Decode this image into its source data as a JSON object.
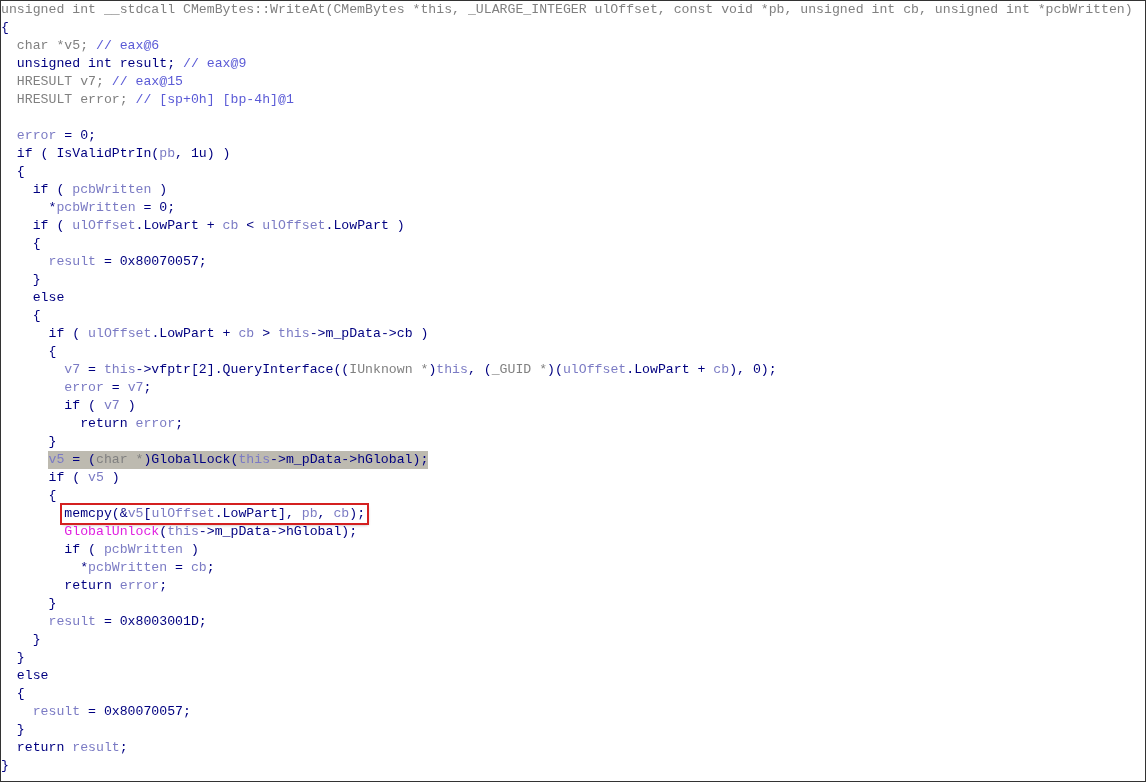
{
  "pseudocode": {
    "lines": [
      {
        "highlighted": false,
        "boxed": false,
        "segments": [
          {
            "kind": "decl",
            "text": "unsigned int __stdcall CMemBytes::WriteAt(CMemBytes *this, _ULARGE_INTEGER ulOffset, const void *pb, unsigned int cb, unsigned int *pcbWritten)"
          }
        ]
      },
      {
        "highlighted": false,
        "boxed": false,
        "segments": [
          {
            "kind": "plain",
            "text": "{"
          }
        ]
      },
      {
        "highlighted": false,
        "boxed": false,
        "segments": [
          {
            "kind": "type",
            "text": "  char *v5; "
          },
          {
            "kind": "comment",
            "text": "// eax@6"
          }
        ]
      },
      {
        "highlighted": false,
        "boxed": false,
        "segments": [
          {
            "kind": "plain",
            "text": "  unsigned int result; "
          },
          {
            "kind": "comment",
            "text": "// eax@9"
          }
        ]
      },
      {
        "highlighted": false,
        "boxed": false,
        "segments": [
          {
            "kind": "type",
            "text": "  HRESULT v7; "
          },
          {
            "kind": "comment",
            "text": "// eax@15"
          }
        ]
      },
      {
        "highlighted": false,
        "boxed": false,
        "segments": [
          {
            "kind": "type",
            "text": "  HRESULT error; "
          },
          {
            "kind": "comment",
            "text": "// [sp+0h] [bp-4h]@1"
          }
        ]
      },
      {
        "highlighted": false,
        "boxed": false
      },
      {
        "highlighted": false,
        "boxed": false,
        "segments": [
          {
            "kind": "var",
            "text": "  error"
          },
          {
            "kind": "plain",
            "text": " = 0;"
          }
        ]
      },
      {
        "highlighted": false,
        "boxed": false,
        "segments": [
          {
            "kind": "plain",
            "text": "  if ( IsValidPtrIn("
          },
          {
            "kind": "var",
            "text": "pb"
          },
          {
            "kind": "plain",
            "text": ", 1u) )"
          }
        ]
      },
      {
        "highlighted": false,
        "boxed": false,
        "segments": [
          {
            "kind": "plain",
            "text": "  {"
          }
        ]
      },
      {
        "highlighted": false,
        "boxed": false,
        "segments": [
          {
            "kind": "plain",
            "text": "    if ( "
          },
          {
            "kind": "var",
            "text": "pcbWritten"
          },
          {
            "kind": "plain",
            "text": " )"
          }
        ]
      },
      {
        "highlighted": false,
        "boxed": false,
        "segments": [
          {
            "kind": "plain",
            "text": "      *"
          },
          {
            "kind": "var",
            "text": "pcbWritten"
          },
          {
            "kind": "plain",
            "text": " = 0;"
          }
        ]
      },
      {
        "highlighted": false,
        "boxed": false,
        "segments": [
          {
            "kind": "plain",
            "text": "    if ( "
          },
          {
            "kind": "var",
            "text": "ulOffset"
          },
          {
            "kind": "plain",
            "text": ".LowPart + "
          },
          {
            "kind": "var",
            "text": "cb"
          },
          {
            "kind": "plain",
            "text": " < "
          },
          {
            "kind": "var",
            "text": "ulOffset"
          },
          {
            "kind": "plain",
            "text": ".LowPart )"
          }
        ]
      },
      {
        "highlighted": false,
        "boxed": false,
        "segments": [
          {
            "kind": "plain",
            "text": "    {"
          }
        ]
      },
      {
        "highlighted": false,
        "boxed": false,
        "segments": [
          {
            "kind": "var",
            "text": "      result"
          },
          {
            "kind": "plain",
            "text": " = 0x80070057;"
          }
        ]
      },
      {
        "highlighted": false,
        "boxed": false,
        "segments": [
          {
            "kind": "plain",
            "text": "    }"
          }
        ]
      },
      {
        "highlighted": false,
        "boxed": false,
        "segments": [
          {
            "kind": "plain",
            "text": "    else"
          }
        ]
      },
      {
        "highlighted": false,
        "boxed": false,
        "segments": [
          {
            "kind": "plain",
            "text": "    {"
          }
        ]
      },
      {
        "highlighted": false,
        "boxed": false,
        "segments": [
          {
            "kind": "plain",
            "text": "      if ( "
          },
          {
            "kind": "var",
            "text": "ulOffset"
          },
          {
            "kind": "plain",
            "text": ".LowPart + "
          },
          {
            "kind": "var",
            "text": "cb"
          },
          {
            "kind": "plain",
            "text": " > "
          },
          {
            "kind": "var",
            "text": "this"
          },
          {
            "kind": "plain",
            "text": "->m_pData->cb )"
          }
        ]
      },
      {
        "highlighted": false,
        "boxed": false,
        "segments": [
          {
            "kind": "plain",
            "text": "      {"
          }
        ]
      },
      {
        "highlighted": false,
        "boxed": false,
        "segments": [
          {
            "kind": "var",
            "text": "        v7"
          },
          {
            "kind": "plain",
            "text": " = "
          },
          {
            "kind": "var",
            "text": "this"
          },
          {
            "kind": "plain",
            "text": "->vfptr[2].QueryInterface(("
          },
          {
            "kind": "type",
            "text": "IUnknown *"
          },
          {
            "kind": "plain",
            "text": ")"
          },
          {
            "kind": "var",
            "text": "this"
          },
          {
            "kind": "plain",
            "text": ", ("
          },
          {
            "kind": "type",
            "text": "_GUID *"
          },
          {
            "kind": "plain",
            "text": ")("
          },
          {
            "kind": "var",
            "text": "ulOffset"
          },
          {
            "kind": "plain",
            "text": ".LowPart + "
          },
          {
            "kind": "var",
            "text": "cb"
          },
          {
            "kind": "plain",
            "text": "), 0);"
          }
        ]
      },
      {
        "highlighted": false,
        "boxed": false,
        "segments": [
          {
            "kind": "var",
            "text": "        error"
          },
          {
            "kind": "plain",
            "text": " = "
          },
          {
            "kind": "var",
            "text": "v7"
          },
          {
            "kind": "plain",
            "text": ";"
          }
        ]
      },
      {
        "highlighted": false,
        "boxed": false,
        "segments": [
          {
            "kind": "plain",
            "text": "        if ( "
          },
          {
            "kind": "var",
            "text": "v7"
          },
          {
            "kind": "plain",
            "text": " )"
          }
        ]
      },
      {
        "highlighted": false,
        "boxed": false,
        "segments": [
          {
            "kind": "plain",
            "text": "          return "
          },
          {
            "kind": "var",
            "text": "error"
          },
          {
            "kind": "plain",
            "text": ";"
          }
        ]
      },
      {
        "highlighted": false,
        "boxed": false,
        "segments": [
          {
            "kind": "plain",
            "text": "      }"
          }
        ]
      },
      {
        "highlighted": true,
        "boxed": false,
        "segments": [
          {
            "kind": "var",
            "text": "      v5"
          },
          {
            "kind": "plain",
            "text": " = ("
          },
          {
            "kind": "type",
            "text": "char *"
          },
          {
            "kind": "plain",
            "text": ")GlobalLock("
          },
          {
            "kind": "var",
            "text": "this"
          },
          {
            "kind": "plain",
            "text": "->m_pData->hGlobal);"
          }
        ]
      },
      {
        "highlighted": false,
        "boxed": false,
        "segments": [
          {
            "kind": "plain",
            "text": "      if ( "
          },
          {
            "kind": "var",
            "text": "v5"
          },
          {
            "kind": "plain",
            "text": " )"
          }
        ]
      },
      {
        "highlighted": false,
        "boxed": false,
        "segments": [
          {
            "kind": "plain",
            "text": "      {"
          }
        ]
      },
      {
        "highlighted": false,
        "boxed": true,
        "segments": [
          {
            "kind": "plain",
            "text": "        memcpy(&"
          },
          {
            "kind": "var",
            "text": "v5"
          },
          {
            "kind": "plain",
            "text": "["
          },
          {
            "kind": "var",
            "text": "ulOffset"
          },
          {
            "kind": "plain",
            "text": ".LowPart], "
          },
          {
            "kind": "var",
            "text": "pb"
          },
          {
            "kind": "plain",
            "text": ", "
          },
          {
            "kind": "var",
            "text": "cb"
          },
          {
            "kind": "plain",
            "text": ");"
          }
        ]
      },
      {
        "highlighted": false,
        "boxed": false,
        "segments": [
          {
            "kind": "import",
            "text": "        GlobalUnlock"
          },
          {
            "kind": "plain",
            "text": "("
          },
          {
            "kind": "var",
            "text": "this"
          },
          {
            "kind": "plain",
            "text": "->m_pData->hGlobal);"
          }
        ]
      },
      {
        "highlighted": false,
        "boxed": false,
        "segments": [
          {
            "kind": "plain",
            "text": "        if ( "
          },
          {
            "kind": "var",
            "text": "pcbWritten"
          },
          {
            "kind": "plain",
            "text": " )"
          }
        ]
      },
      {
        "highlighted": false,
        "boxed": false,
        "segments": [
          {
            "kind": "plain",
            "text": "          *"
          },
          {
            "kind": "var",
            "text": "pcbWritten"
          },
          {
            "kind": "plain",
            "text": " = "
          },
          {
            "kind": "var",
            "text": "cb"
          },
          {
            "kind": "plain",
            "text": ";"
          }
        ]
      },
      {
        "highlighted": false,
        "boxed": false,
        "segments": [
          {
            "kind": "plain",
            "text": "        return "
          },
          {
            "kind": "var",
            "text": "error"
          },
          {
            "kind": "plain",
            "text": ";"
          }
        ]
      },
      {
        "highlighted": false,
        "boxed": false,
        "segments": [
          {
            "kind": "plain",
            "text": "      }"
          }
        ]
      },
      {
        "highlighted": false,
        "boxed": false,
        "segments": [
          {
            "kind": "var",
            "text": "      result"
          },
          {
            "kind": "plain",
            "text": " = 0x8003001D;"
          }
        ]
      },
      {
        "highlighted": false,
        "boxed": false,
        "segments": [
          {
            "kind": "plain",
            "text": "    }"
          }
        ]
      },
      {
        "highlighted": false,
        "boxed": false,
        "segments": [
          {
            "kind": "plain",
            "text": "  }"
          }
        ]
      },
      {
        "highlighted": false,
        "boxed": false,
        "segments": [
          {
            "kind": "plain",
            "text": "  else"
          }
        ]
      },
      {
        "highlighted": false,
        "boxed": false,
        "segments": [
          {
            "kind": "plain",
            "text": "  {"
          }
        ]
      },
      {
        "highlighted": false,
        "boxed": false,
        "segments": [
          {
            "kind": "var",
            "text": "    result"
          },
          {
            "kind": "plain",
            "text": " = 0x80070057;"
          }
        ]
      },
      {
        "highlighted": false,
        "boxed": false,
        "segments": [
          {
            "kind": "plain",
            "text": "  }"
          }
        ]
      },
      {
        "highlighted": false,
        "boxed": false,
        "segments": [
          {
            "kind": "plain",
            "text": "  return "
          },
          {
            "kind": "var",
            "text": "result"
          },
          {
            "kind": "plain",
            "text": ";"
          }
        ]
      },
      {
        "highlighted": false,
        "boxed": false,
        "segments": [
          {
            "kind": "plain",
            "text": "}"
          }
        ]
      }
    ]
  }
}
